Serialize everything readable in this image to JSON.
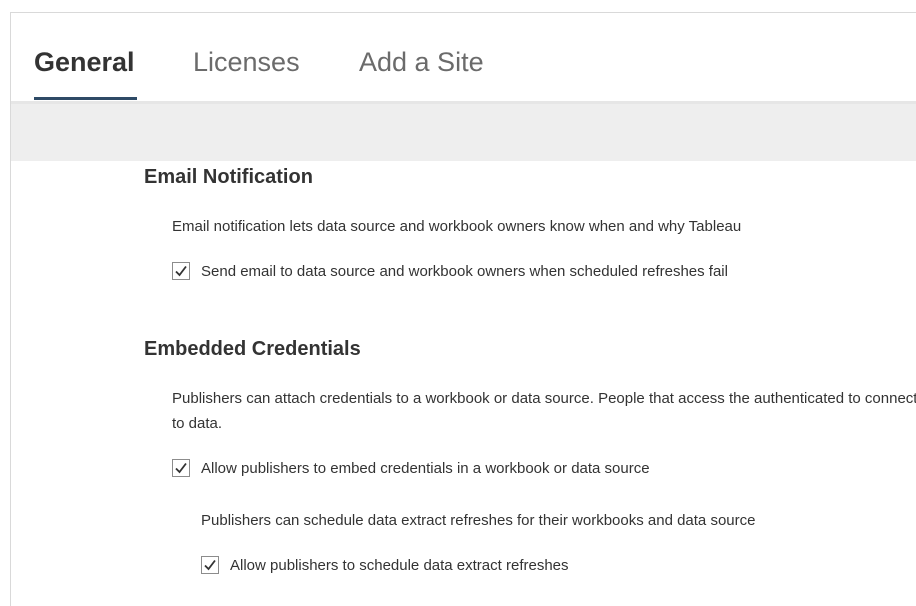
{
  "tabs": [
    {
      "label": "General",
      "active": true
    },
    {
      "label": "Licenses",
      "active": false
    },
    {
      "label": "Add a Site",
      "active": false
    }
  ],
  "email_notification": {
    "title": "Email Notification",
    "description": "Email notification lets data source and workbook owners know when and why Tableau",
    "checkbox": {
      "label": "Send email to data source and workbook owners when scheduled refreshes fail",
      "checked": true
    }
  },
  "embedded_credentials": {
    "title": "Embedded Credentials",
    "description": "Publishers can attach credentials to a workbook or data source. People that access the authenticated to connect to data.",
    "checkbox": {
      "label": "Allow publishers to embed credentials in a workbook or data source",
      "checked": true
    },
    "sub_description": "Publishers can schedule data extract refreshes for their workbooks and data source",
    "sub_checkbox": {
      "label": "Allow publishers to schedule data extract refreshes",
      "checked": true
    }
  },
  "colors": {
    "active_tab_underline": "#2e4a66",
    "toolbar_bg": "#eeeeee",
    "text": "#333333"
  }
}
